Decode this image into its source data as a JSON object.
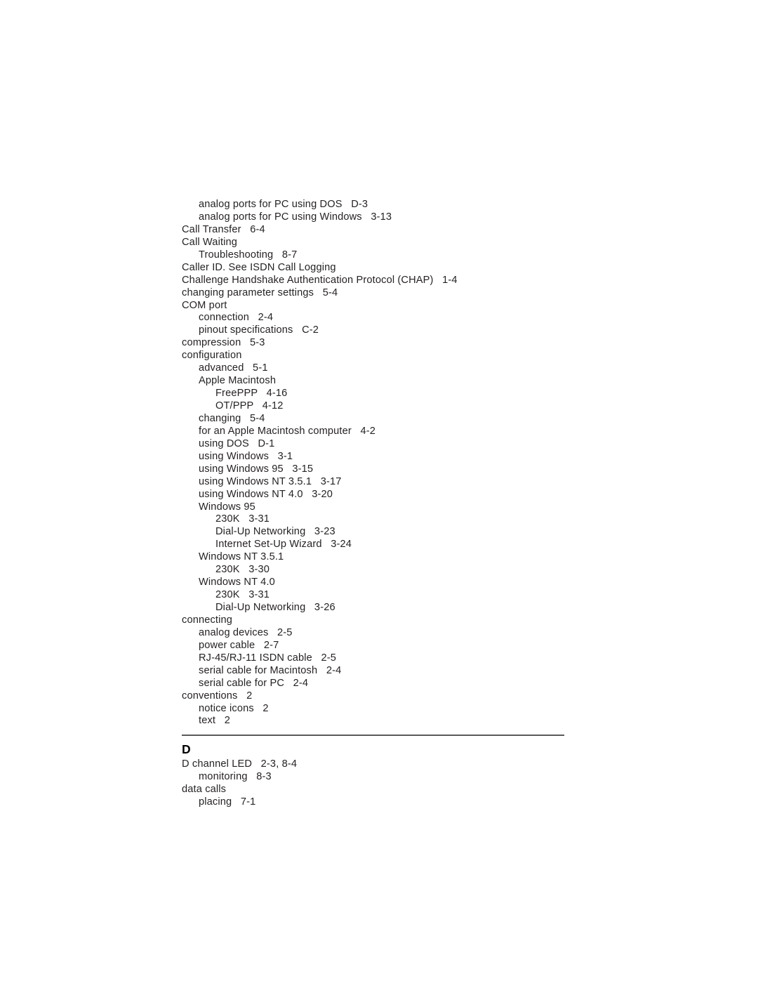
{
  "page": {
    "background_color": "#ffffff",
    "text_color": "#262223",
    "rule_color": "#5a5a5a",
    "document_type": "index"
  },
  "index": {
    "continued_entries": [
      {
        "level": 1,
        "text": "analog ports for PC using DOS   D-3"
      },
      {
        "level": 1,
        "text": "analog ports for PC using Windows   3-13"
      },
      {
        "level": 0,
        "text": "Call Transfer   6-4"
      },
      {
        "level": 0,
        "text": "Call Waiting"
      },
      {
        "level": 1,
        "text": "Troubleshooting   8-7"
      },
      {
        "level": 0,
        "text": "Caller ID. See ISDN Call Logging"
      },
      {
        "level": 0,
        "text": "Challenge Handshake Authentication Protocol (CHAP)   1-4"
      },
      {
        "level": 0,
        "text": "changing parameter settings   5-4"
      },
      {
        "level": 0,
        "text": "COM port"
      },
      {
        "level": 1,
        "text": "connection   2-4"
      },
      {
        "level": 1,
        "text": "pinout specifications   C-2"
      },
      {
        "level": 0,
        "text": "compression   5-3"
      },
      {
        "level": 0,
        "text": "configuration"
      },
      {
        "level": 1,
        "text": "advanced   5-1"
      },
      {
        "level": 1,
        "text": "Apple Macintosh"
      },
      {
        "level": 2,
        "text": "FreePPP   4-16"
      },
      {
        "level": 2,
        "text": "OT/PPP   4-12"
      },
      {
        "level": 1,
        "text": "changing   5-4"
      },
      {
        "level": 1,
        "text": "for an Apple Macintosh computer   4-2"
      },
      {
        "level": 1,
        "text": "using DOS   D-1"
      },
      {
        "level": 1,
        "text": "using Windows   3-1"
      },
      {
        "level": 1,
        "text": "using Windows 95   3-15"
      },
      {
        "level": 1,
        "text": "using Windows NT 3.5.1   3-17"
      },
      {
        "level": 1,
        "text": "using Windows NT 4.0   3-20"
      },
      {
        "level": 1,
        "text": "Windows 95"
      },
      {
        "level": 2,
        "text": "230K   3-31"
      },
      {
        "level": 2,
        "text": "Dial-Up Networking   3-23"
      },
      {
        "level": 2,
        "text": "Internet Set-Up Wizard   3-24"
      },
      {
        "level": 1,
        "text": "Windows NT 3.5.1"
      },
      {
        "level": 2,
        "text": "230K   3-30"
      },
      {
        "level": 1,
        "text": "Windows NT 4.0"
      },
      {
        "level": 2,
        "text": "230K   3-31"
      },
      {
        "level": 2,
        "text": "Dial-Up Networking   3-26"
      },
      {
        "level": 0,
        "text": "connecting"
      },
      {
        "level": 1,
        "text": "analog devices   2-5"
      },
      {
        "level": 1,
        "text": "power cable   2-7"
      },
      {
        "level": 1,
        "text": "RJ-45/RJ-11 ISDN cable   2-5"
      },
      {
        "level": 1,
        "text": "serial cable for Macintosh   2-4"
      },
      {
        "level": 1,
        "text": "serial cable for PC   2-4"
      },
      {
        "level": 0,
        "text": "conventions   2"
      },
      {
        "level": 1,
        "text": "notice icons   2"
      },
      {
        "level": 1,
        "text": "text   2"
      }
    ],
    "sections": [
      {
        "letter": "D",
        "entries": [
          {
            "level": 0,
            "text": "D channel LED   2-3, 8-4"
          },
          {
            "level": 1,
            "text": "monitoring   8-3"
          },
          {
            "level": 0,
            "text": "data calls"
          },
          {
            "level": 1,
            "text": "placing   7-1"
          }
        ]
      }
    ]
  }
}
